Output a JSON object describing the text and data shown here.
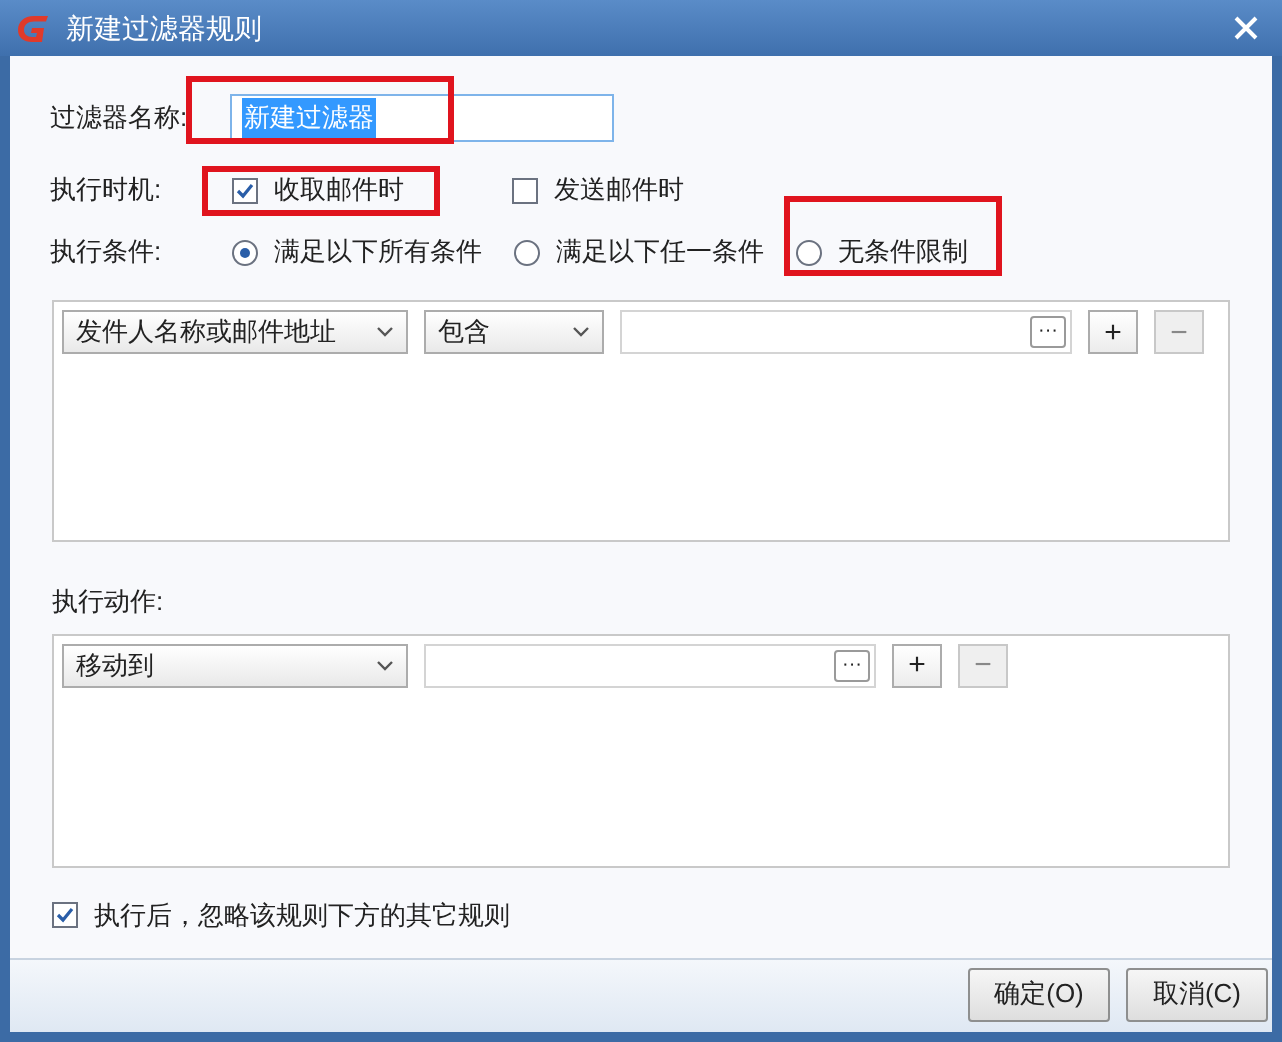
{
  "window": {
    "title": "新建过滤器规则"
  },
  "name_field": {
    "label": "过滤器名称:",
    "value": "新建过滤器"
  },
  "timing": {
    "label": "执行时机:",
    "options": [
      {
        "label": "收取邮件时",
        "checked": true
      },
      {
        "label": "发送邮件时",
        "checked": false
      }
    ]
  },
  "conditions_mode": {
    "label": "执行条件:",
    "options": [
      {
        "label": "满足以下所有条件",
        "selected": true
      },
      {
        "label": "满足以下任一条件",
        "selected": false
      },
      {
        "label": "无条件限制",
        "selected": false
      }
    ]
  },
  "conditions": [
    {
      "field": "发件人名称或邮件地址",
      "operator": "包含",
      "more": "···",
      "add": "+",
      "remove": "−"
    }
  ],
  "actions_label": "执行动作:",
  "actions": [
    {
      "action": "移动到",
      "more": "···",
      "add": "+",
      "remove": "−"
    }
  ],
  "stop_processing": {
    "label": "执行后，忽略该规则下方的其它规则",
    "checked": true
  },
  "buttons": [
    "确定(O)",
    "取消(C)"
  ]
}
